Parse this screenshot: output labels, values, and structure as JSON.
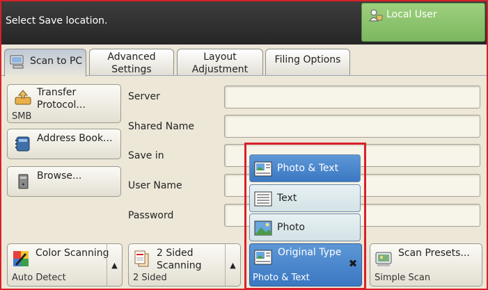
{
  "header": {
    "prompt": "Select Save location.",
    "local_user_label": "Local User"
  },
  "tabs": [
    {
      "label": "Scan to PC",
      "active": true
    },
    {
      "label": "Advanced Settings"
    },
    {
      "label": "Layout Adjustment"
    },
    {
      "label": "Filing Options"
    }
  ],
  "side_buttons": {
    "transfer": {
      "label": "Transfer Protocol...",
      "value": "SMB"
    },
    "address_book": {
      "label": "Address Book..."
    },
    "browse": {
      "label": "Browse..."
    }
  },
  "fields": [
    {
      "label": "Server",
      "value": ""
    },
    {
      "label": "Shared Name",
      "value": ""
    },
    {
      "label": "Save in",
      "value": ""
    },
    {
      "label": "User Name",
      "value": ""
    },
    {
      "label": "Password",
      "value": ""
    }
  ],
  "bottom": {
    "color": {
      "label": "Color Scanning",
      "value": "Auto Detect"
    },
    "sided": {
      "label": "2 Sided Scanning",
      "value": "2 Sided"
    },
    "original_type": {
      "label": "Original Type",
      "value": "Photo & Text"
    },
    "presets": {
      "label": "Scan Presets...",
      "value": "Simple Scan"
    }
  },
  "original_type_options": [
    {
      "label": "Photo & Text",
      "selected": true
    },
    {
      "label": "Text"
    },
    {
      "label": "Photo"
    }
  ],
  "colors": {
    "highlight_frame": "#d8202a",
    "selected_blue": "#3b78c2",
    "local_user_green": "#8cc46e"
  }
}
